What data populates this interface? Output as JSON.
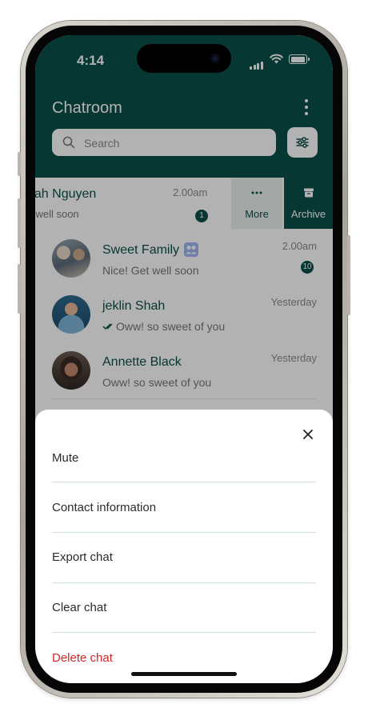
{
  "status_bar": {
    "time": "4:14"
  },
  "app": {
    "title": "Chatroom",
    "search_placeholder": "Search"
  },
  "swiped_row": {
    "name": "hah Nguyen",
    "message": "et well soon",
    "time": "2.00am",
    "unread": "1",
    "actions": [
      {
        "label": "More",
        "icon": "more-icon"
      },
      {
        "label": "Archive",
        "icon": "archive-icon"
      }
    ]
  },
  "chats": [
    {
      "name": "Sweet Family",
      "message": "Nice! Get well soon",
      "time": "2.00am",
      "unread": "10",
      "badge": "group-icon"
    },
    {
      "name": "jeklin Shah",
      "message": "Oww! so sweet of you",
      "time": "Yesterday",
      "status": "double-check-icon"
    },
    {
      "name": "Annette Black",
      "message": "Oww! so sweet of you",
      "time": "Yesterday"
    }
  ],
  "sheet": {
    "items": [
      {
        "label": "Mute"
      },
      {
        "label": "Contact information"
      },
      {
        "label": "Export chat"
      },
      {
        "label": "Clear chat"
      },
      {
        "label": "Delete chat",
        "danger": true
      }
    ]
  },
  "colors": {
    "brand": "#0b4f48",
    "danger": "#d1282a",
    "divider": "#cfe0dd"
  }
}
